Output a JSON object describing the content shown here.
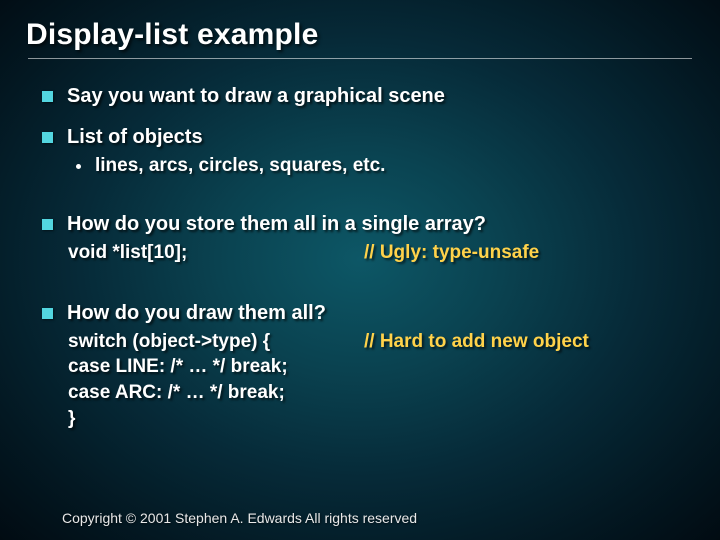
{
  "title": "Display-list example",
  "bullets": {
    "b1": "Say you want to draw a graphical scene",
    "b2": "List of objects",
    "b2_sub": "lines, arcs, circles, squares, etc.",
    "b3": "How do you store them all in a single array?",
    "b3_code": "void *list[10];",
    "b3_comment": "// Ugly: type-unsafe",
    "b4": "How do you draw them all?",
    "b4_code1": "switch (object->type) {",
    "b4_comment": "// Hard to add new object",
    "b4_code2": "case LINE: /* … */ break;",
    "b4_code3": "case ARC: /* … */ break;",
    "b4_code4": "}"
  },
  "copyright": "Copyright © 2001 Stephen A. Edwards  All rights reserved"
}
